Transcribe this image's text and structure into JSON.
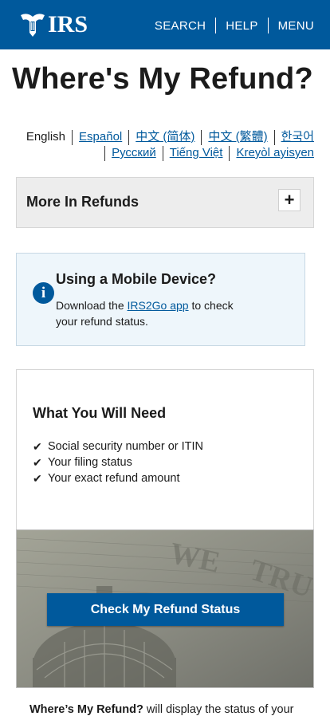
{
  "header": {
    "logo_text": "IRS",
    "nav": [
      "SEARCH",
      "HELP",
      "MENU"
    ]
  },
  "page_title": "Where's My Refund?",
  "languages": {
    "row1": [
      "English",
      "Español",
      "中文 (简体)",
      "中文 (繁體)",
      "한국어"
    ],
    "row2": [
      "Русский",
      "Tiếng Việt",
      "Kreyòl ayisyen"
    ]
  },
  "accordion": {
    "label": "More In Refunds",
    "toggle": "+"
  },
  "mobile_notice": {
    "title": "Using a Mobile Device?",
    "text_before": "Download the ",
    "link": "IRS2Go app",
    "text_after": " to check your refund status."
  },
  "need": {
    "title": "What You Will Need",
    "items": [
      "Social security number or ITIN",
      "Your filing status",
      "Your exact refund amount"
    ]
  },
  "cta": {
    "label": "Check My Refund Status"
  },
  "footer": {
    "bold": "Where’s My Refund?",
    "rest": " will display the status of your"
  },
  "colors": {
    "brand_blue": "#00599c",
    "info_bg": "#eef6fb",
    "accordion_bg": "#ededed"
  }
}
